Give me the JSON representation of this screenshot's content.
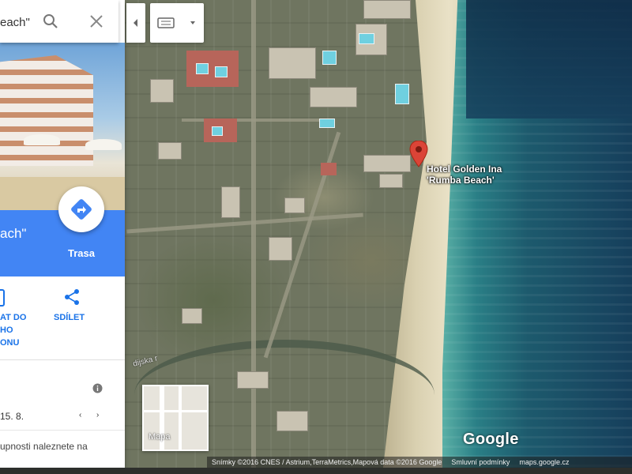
{
  "search": {
    "text": "each\""
  },
  "place": {
    "title": "ach\"",
    "map_label": "Hotel Golden Ina\n'Rumba Beach'"
  },
  "actions": {
    "route_label": "Trasa",
    "send_label": "AT DO\nHO\nONU",
    "share_label": "SDÍLET"
  },
  "info": {
    "date": "15. 8.",
    "prev": "‹",
    "next": "›",
    "more": "upnosti naleznete na"
  },
  "minimap": {
    "label": "Mapa"
  },
  "logo": "Google",
  "footer": {
    "attribution": "Snímky ©2016 CNES / Astrium,TerraMetrics,Mapová data ©2016 Google",
    "terms": "Smluvní podmínky",
    "url": "maps.google.cz"
  },
  "road_label": "dijska r",
  "icons": {
    "search": "search-icon",
    "close": "close-icon",
    "route": "directions-icon",
    "send": "send-to-phone-icon",
    "share": "share-icon",
    "info": "info-icon",
    "pin": "map-pin-icon",
    "collapse": "chevron-left-icon",
    "keyboard": "keyboard-icon"
  },
  "colors": {
    "accent": "#4285f4",
    "action_text": "#1a73e8",
    "pin": "#db4437"
  }
}
